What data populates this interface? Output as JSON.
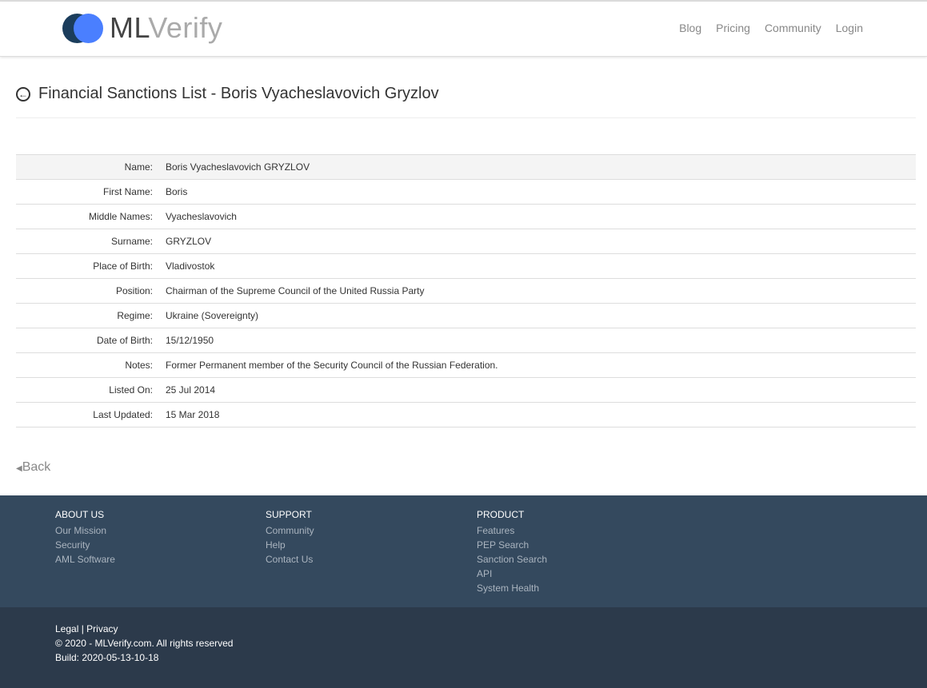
{
  "header": {
    "logo_ml": "ML",
    "logo_verify": "Verify",
    "nav": [
      "Blog",
      "Pricing",
      "Community",
      "Login"
    ]
  },
  "page": {
    "title": "Financial Sanctions List - Boris Vyacheslavovich Gryzlov",
    "back": "Back"
  },
  "details": [
    {
      "label": "Name:",
      "value": "Boris Vyacheslavovich GRYZLOV"
    },
    {
      "label": "First Name:",
      "value": "Boris"
    },
    {
      "label": "Middle Names:",
      "value": "Vyacheslavovich"
    },
    {
      "label": "Surname:",
      "value": "GRYZLOV"
    },
    {
      "label": "Place of Birth:",
      "value": "Vladivostok"
    },
    {
      "label": "Position:",
      "value": "Chairman of the Supreme Council of the United Russia Party"
    },
    {
      "label": "Regime:",
      "value": "Ukraine (Sovereignty)"
    },
    {
      "label": "Date of Birth:",
      "value": "15/12/1950"
    },
    {
      "label": "Notes:",
      "value": "Former Permanent member of the Security Council of the Russian Federation."
    },
    {
      "label": "Listed On:",
      "value": "25 Jul 2014"
    },
    {
      "label": "Last Updated:",
      "value": "15 Mar 2018"
    }
  ],
  "footer": {
    "about": {
      "title": "ABOUT US",
      "links": [
        "Our Mission",
        "Security",
        "AML Software"
      ]
    },
    "support": {
      "title": "SUPPORT",
      "links": [
        "Community",
        "Help",
        "Contact Us"
      ]
    },
    "product": {
      "title": "PRODUCT",
      "links": [
        "Features",
        "PEP Search",
        "Sanction Search",
        "API",
        "System Health"
      ]
    },
    "legal": "Legal",
    "sep": " | ",
    "privacy": "Privacy",
    "copyright": "© 2020 - MLVerify.com. All rights reserved",
    "build": "Build: 2020-05-13-10-18"
  }
}
